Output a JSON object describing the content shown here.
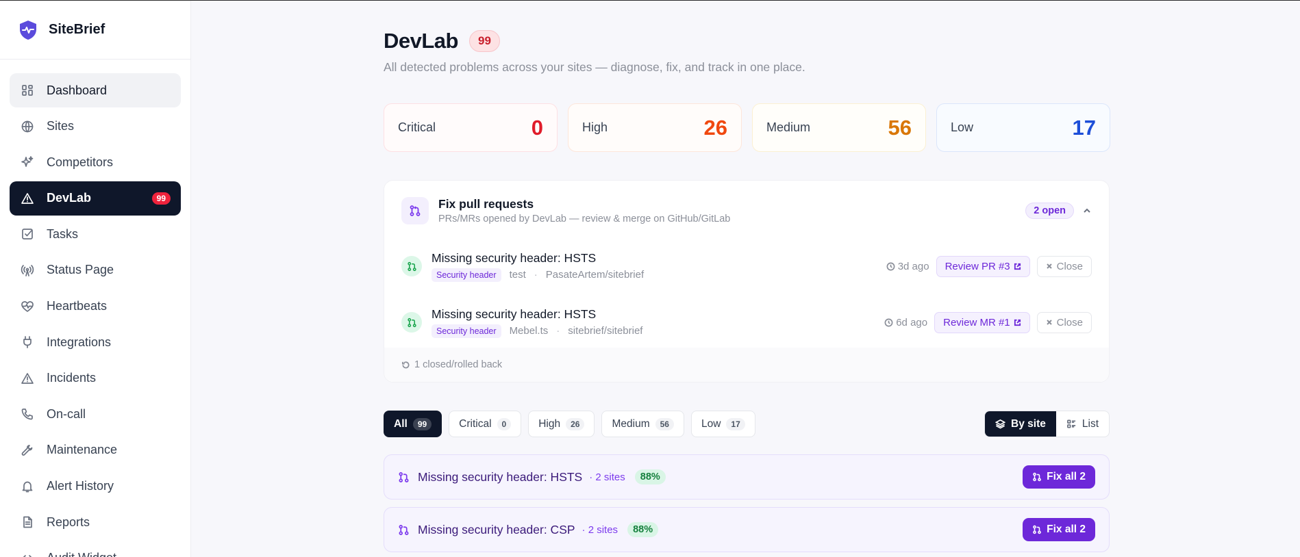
{
  "brand": {
    "name": "SiteBrief"
  },
  "sidebar": {
    "items": [
      {
        "label": "Dashboard",
        "icon": "grid-icon"
      },
      {
        "label": "Sites",
        "icon": "globe-icon"
      },
      {
        "label": "Competitors",
        "icon": "sparkles-icon"
      },
      {
        "label": "DevLab",
        "icon": "warning-icon",
        "badge": "99"
      },
      {
        "label": "Tasks",
        "icon": "checkbox-icon"
      },
      {
        "label": "Status Page",
        "icon": "broadcast-icon"
      },
      {
        "label": "Heartbeats",
        "icon": "heart-pulse-icon"
      },
      {
        "label": "Integrations",
        "icon": "plug-icon"
      },
      {
        "label": "Incidents",
        "icon": "alert-triangle-icon"
      },
      {
        "label": "On-call",
        "icon": "phone-icon"
      },
      {
        "label": "Maintenance",
        "icon": "wrench-icon"
      },
      {
        "label": "Alert History",
        "icon": "bell-icon"
      },
      {
        "label": "Reports",
        "icon": "file-icon"
      },
      {
        "label": "Audit Widget",
        "icon": "code-icon"
      }
    ]
  },
  "header": {
    "title": "DevLab",
    "badge": "99",
    "subtitle": "All detected problems across your sites — diagnose, fix, and track in one place."
  },
  "stats": [
    {
      "label": "Critical",
      "value": "0"
    },
    {
      "label": "High",
      "value": "26"
    },
    {
      "label": "Medium",
      "value": "56"
    },
    {
      "label": "Low",
      "value": "17"
    }
  ],
  "pr_panel": {
    "title": "Fix pull requests",
    "subtitle": "PRs/MRs opened by DevLab — review & merge on GitHub/GitLab",
    "open_badge": "2 open",
    "rows": [
      {
        "title": "Missing security header: HSTS",
        "tag": "Security header",
        "site": "test",
        "repo": "PasateArtem/sitebrief",
        "ago": "3d ago",
        "review": "Review PR #3",
        "close": "Close"
      },
      {
        "title": "Missing security header: HSTS",
        "tag": "Security header",
        "site": "Mebel.ts",
        "repo": "sitebrief/sitebrief",
        "ago": "6d ago",
        "review": "Review MR #1",
        "close": "Close"
      }
    ],
    "footer": "1 closed/rolled back"
  },
  "filters": [
    {
      "label": "All",
      "count": "99"
    },
    {
      "label": "Critical",
      "count": "0"
    },
    {
      "label": "High",
      "count": "26"
    },
    {
      "label": "Medium",
      "count": "56"
    },
    {
      "label": "Low",
      "count": "17"
    }
  ],
  "view_toggle": {
    "by_site": "By site",
    "list": "List"
  },
  "groups": [
    {
      "title": "Missing security header: HSTS",
      "sites": "· 2 sites",
      "pct": "88%",
      "fix": "Fix all 2"
    },
    {
      "title": "Missing security header: CSP",
      "sites": "· 2 sites",
      "pct": "88%",
      "fix": "Fix all 2"
    }
  ],
  "colors": {
    "accent": "#6d28d9",
    "dark": "#0f172a",
    "critical": "#e01b2a",
    "high": "#f0480f",
    "medium": "#d97706",
    "low": "#1d4ed8"
  }
}
